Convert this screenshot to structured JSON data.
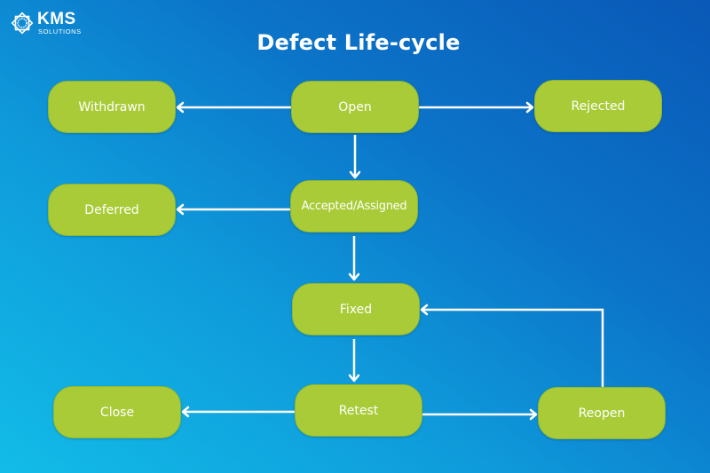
{
  "brand": {
    "name": "KMS",
    "tagline": "SOLUTIONS",
    "logo_icon": "sun-gear-icon"
  },
  "title": "Defect Life-cycle",
  "colors": {
    "background_light": "#12BCE8",
    "background_dark": "#0A58B7",
    "node_fill": "#A9CB37",
    "node_text": "#FFFFFF",
    "arrow": "#FFFFFF"
  },
  "nodes": {
    "withdrawn": "Withdrawn",
    "open": "Open",
    "rejected": "Rejected",
    "deferred": "Deferred",
    "accepted": "Accepted/Assigned",
    "fixed": "Fixed",
    "close": "Close",
    "retest": "Retest",
    "reopen": "Reopen"
  },
  "edges": [
    {
      "from": "Open",
      "to": "Withdrawn"
    },
    {
      "from": "Open",
      "to": "Rejected"
    },
    {
      "from": "Open",
      "to": "Accepted/Assigned"
    },
    {
      "from": "Accepted/Assigned",
      "to": "Deferred"
    },
    {
      "from": "Accepted/Assigned",
      "to": "Fixed"
    },
    {
      "from": "Fixed",
      "to": "Retest"
    },
    {
      "from": "Retest",
      "to": "Close"
    },
    {
      "from": "Retest",
      "to": "Reopen"
    },
    {
      "from": "Reopen",
      "to": "Fixed"
    }
  ]
}
